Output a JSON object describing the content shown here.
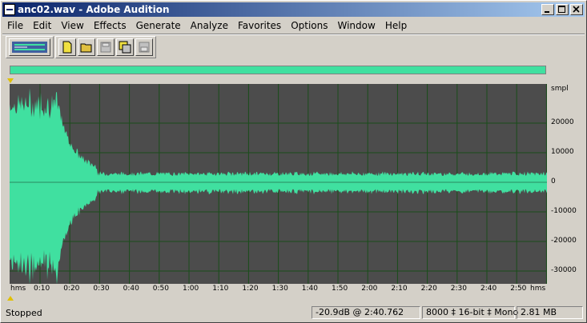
{
  "window": {
    "title": "anc02.wav - Adobe Audition"
  },
  "menu": [
    "File",
    "Edit",
    "View",
    "Effects",
    "Generate",
    "Analyze",
    "Favorites",
    "Options",
    "Window",
    "Help"
  ],
  "amplitude_axis": {
    "unit": "smpl",
    "labels": [
      "20000",
      "10000",
      "0",
      "-10000",
      "-20000",
      "-30000"
    ]
  },
  "time_axis": {
    "start": "hms",
    "end": "hms",
    "labels": [
      "0:10",
      "0:20",
      "0:30",
      "0:40",
      "0:50",
      "1:00",
      "1:10",
      "1:20",
      "1:30",
      "1:40",
      "1:50",
      "2:00",
      "2:10",
      "2:20",
      "2:30",
      "2:40",
      "2:50"
    ]
  },
  "status": {
    "state": "Stopped",
    "level_time": "-20.9dB @  2:40.762",
    "format": "8000 ‡ 16-bit ‡ Mono",
    "size": "2.81 MB"
  },
  "colors": {
    "waveform": "#40e0a0",
    "background": "#4c4c4c",
    "grid": "#1a4d1a",
    "title_gradient_start": "#0a246a",
    "title_gradient_end": "#a6caf0"
  }
}
